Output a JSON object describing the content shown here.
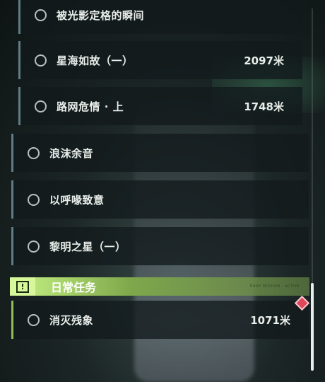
{
  "quests": [
    {
      "title": "被光影定格的瞬间",
      "distance": ""
    },
    {
      "title": "星海如故（一）",
      "distance": "2097米"
    },
    {
      "title": "路网危情 · 上",
      "distance": "1748米"
    },
    {
      "title": "浪沫余音",
      "distance": ""
    },
    {
      "title": "以呼喙致意",
      "distance": ""
    },
    {
      "title": "黎明之星（一）",
      "distance": ""
    }
  ],
  "daily_section": {
    "title": "日常任务",
    "icon": "exclamation-icon",
    "tag": "DAILY MISSION · ACTIVE"
  },
  "daily_quests": [
    {
      "title": "消灭残象",
      "distance": "1071米"
    }
  ],
  "colors": {
    "accent_green": "#c8f08a",
    "row_border": "#5e7d86",
    "marker_red": "#e0465a"
  }
}
